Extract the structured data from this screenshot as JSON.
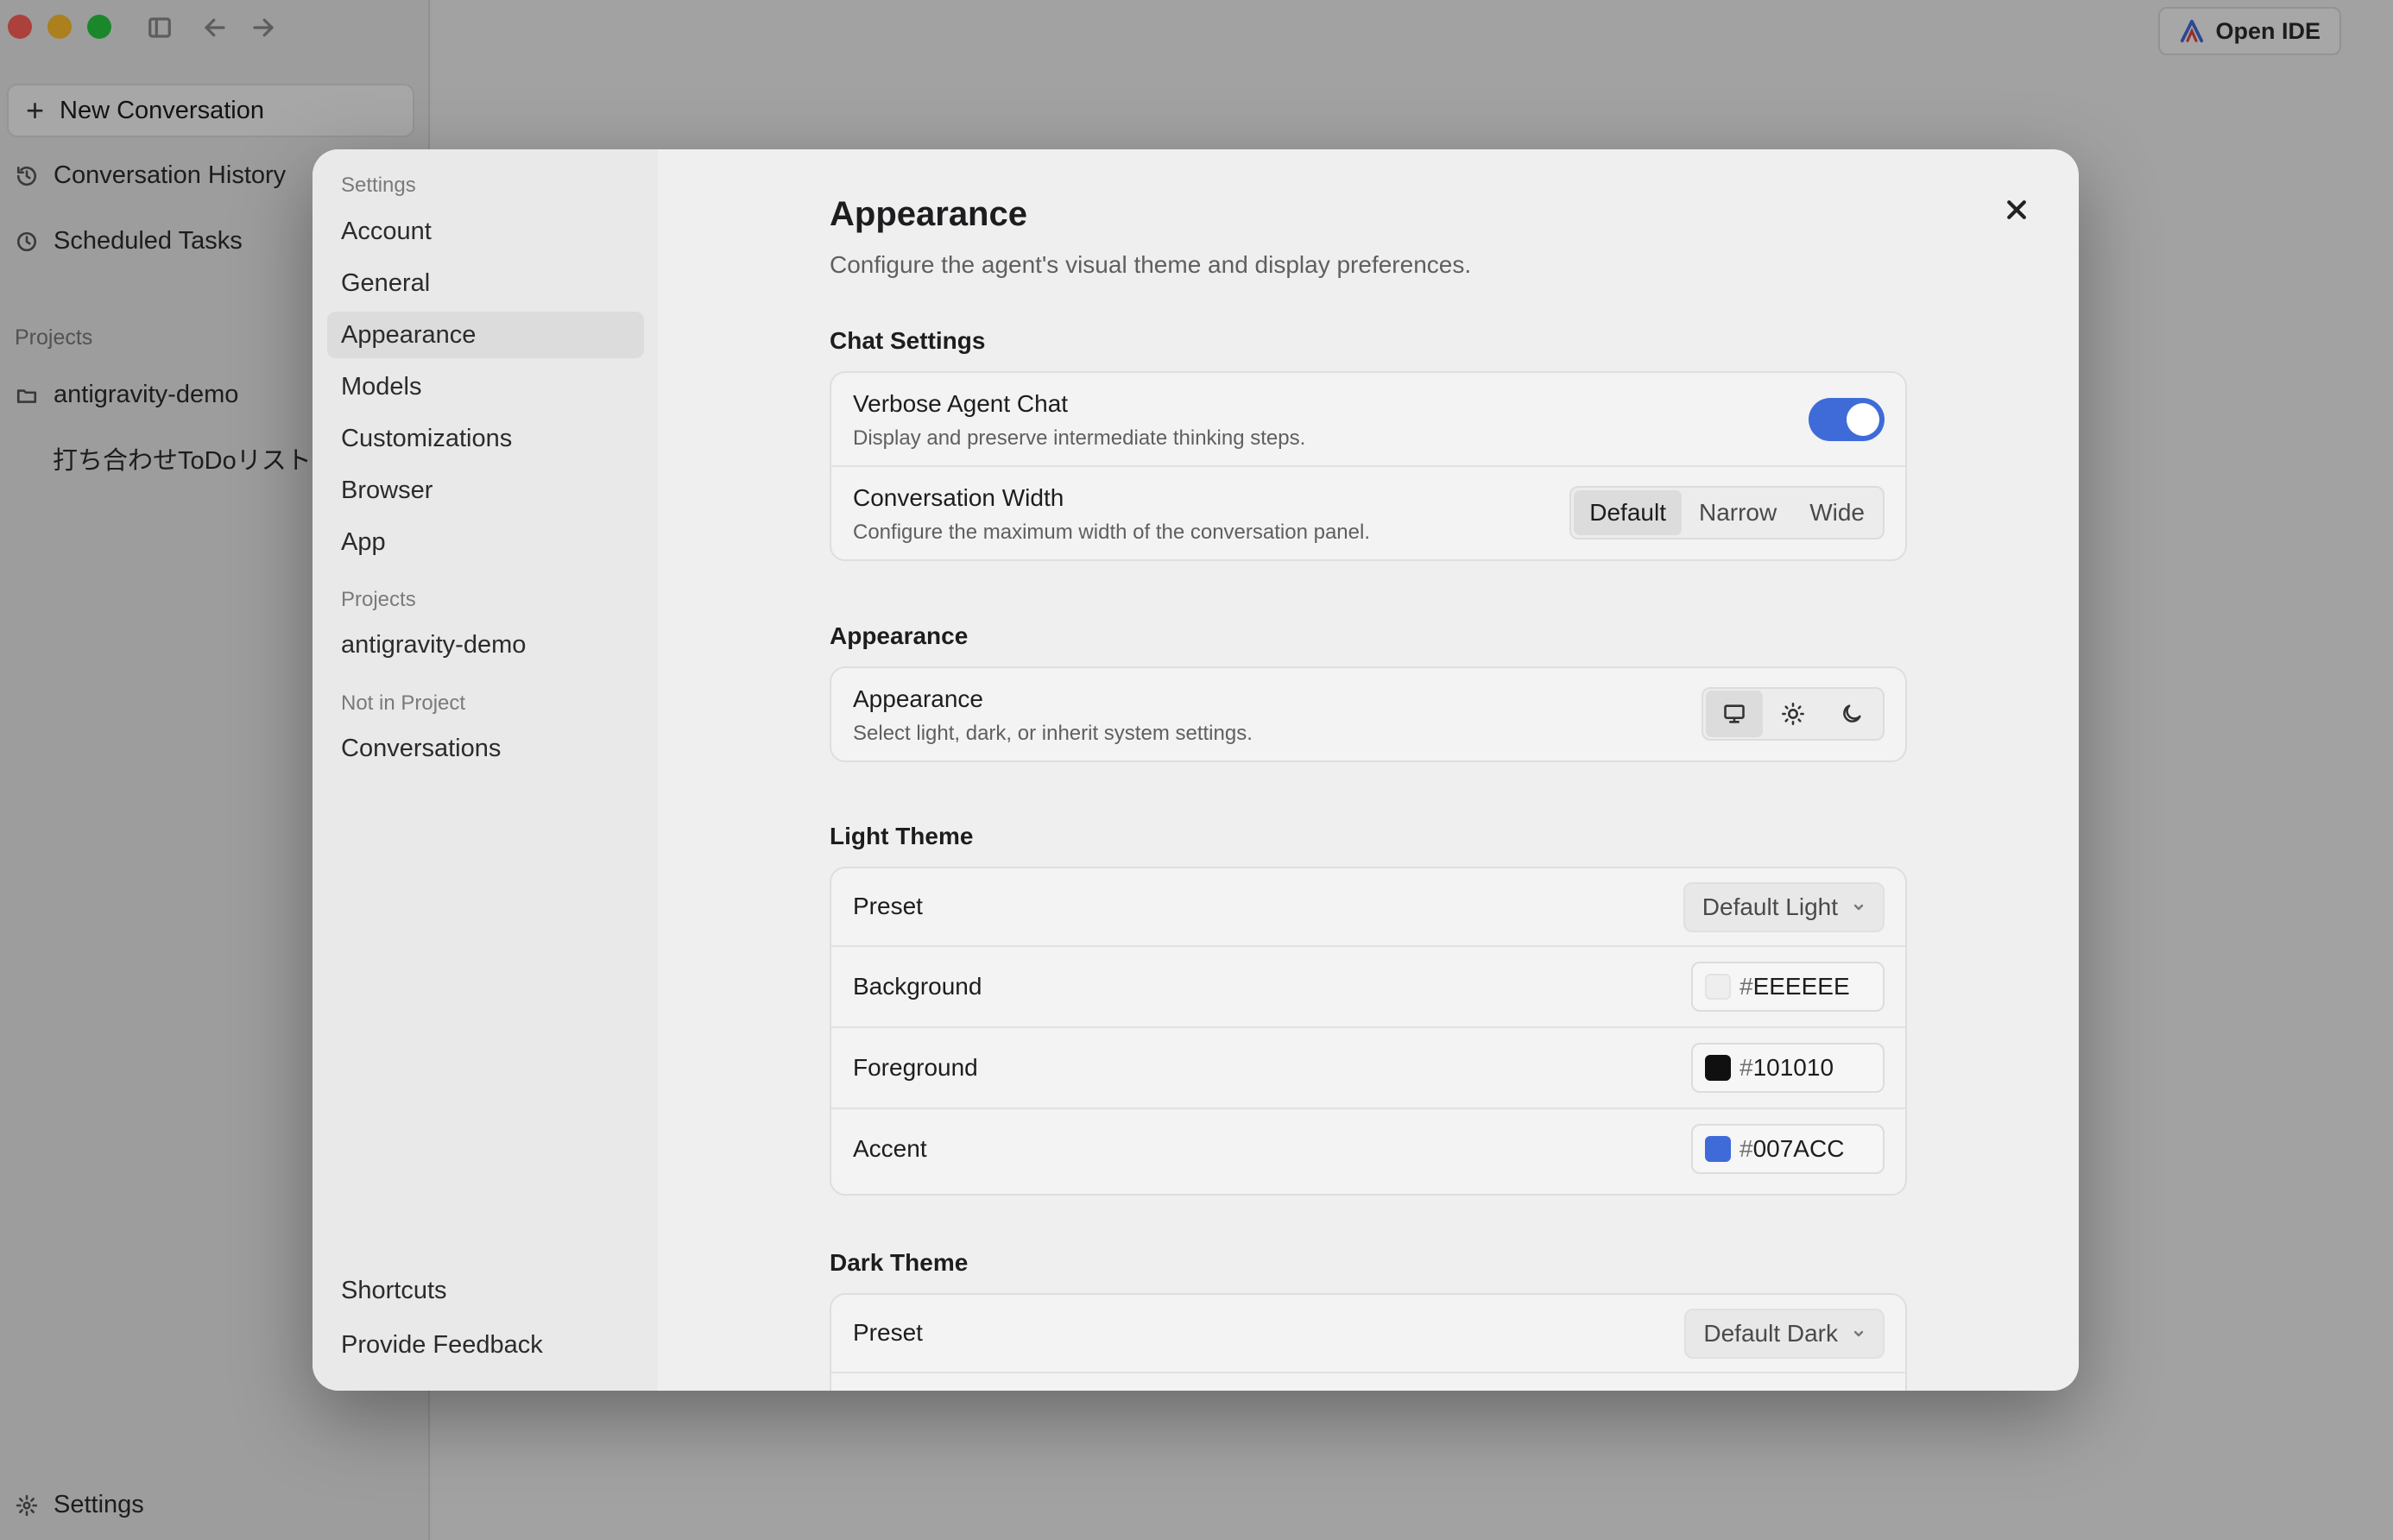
{
  "app": {
    "new_conversation": "New Conversation",
    "conversation_history": "Conversation History",
    "scheduled_tasks": "Scheduled Tasks",
    "projects_heading": "Projects",
    "project_name": "antigravity-demo",
    "project_conversation": "打ち合わせToDoリストを作成",
    "settings": "Settings",
    "open_ide": "Open IDE"
  },
  "nav": {
    "settings_heading": "Settings",
    "items": [
      "Account",
      "General",
      "Appearance",
      "Models",
      "Customizations",
      "Browser",
      "App"
    ],
    "active": "Appearance",
    "projects_heading": "Projects",
    "project_item": "antigravity-demo",
    "not_in_project_heading": "Not in Project",
    "conversations_item": "Conversations",
    "shortcuts": "Shortcuts",
    "feedback": "Provide Feedback"
  },
  "page": {
    "title": "Appearance",
    "description": "Configure the agent's visual theme and display preferences."
  },
  "chat_settings": {
    "title": "Chat Settings",
    "verbose": {
      "label": "Verbose Agent Chat",
      "description": "Display and preserve intermediate thinking steps.",
      "enabled": true
    },
    "width": {
      "label": "Conversation Width",
      "description": "Configure the maximum width of the conversation panel.",
      "options": [
        "Default",
        "Narrow",
        "Wide"
      ],
      "selected": "Default"
    }
  },
  "appearance": {
    "title": "Appearance",
    "label": "Appearance",
    "description": "Select light, dark, or inherit system settings.",
    "modes": [
      "monitor-icon",
      "sun-icon",
      "moon-icon"
    ],
    "selected": "monitor-icon"
  },
  "light_theme": {
    "title": "Light Theme",
    "preset_label": "Preset",
    "preset_value": "Default Light",
    "background_label": "Background",
    "background_value": "EEEEEE",
    "background_color": "#EEEEEE",
    "foreground_label": "Foreground",
    "foreground_value": "101010",
    "foreground_color": "#101010",
    "accent_label": "Accent",
    "accent_value": "007ACC",
    "accent_color": "#3f6bd9"
  },
  "dark_theme": {
    "title": "Dark Theme",
    "preset_label": "Preset",
    "preset_value": "Default Dark"
  },
  "hash": "#"
}
